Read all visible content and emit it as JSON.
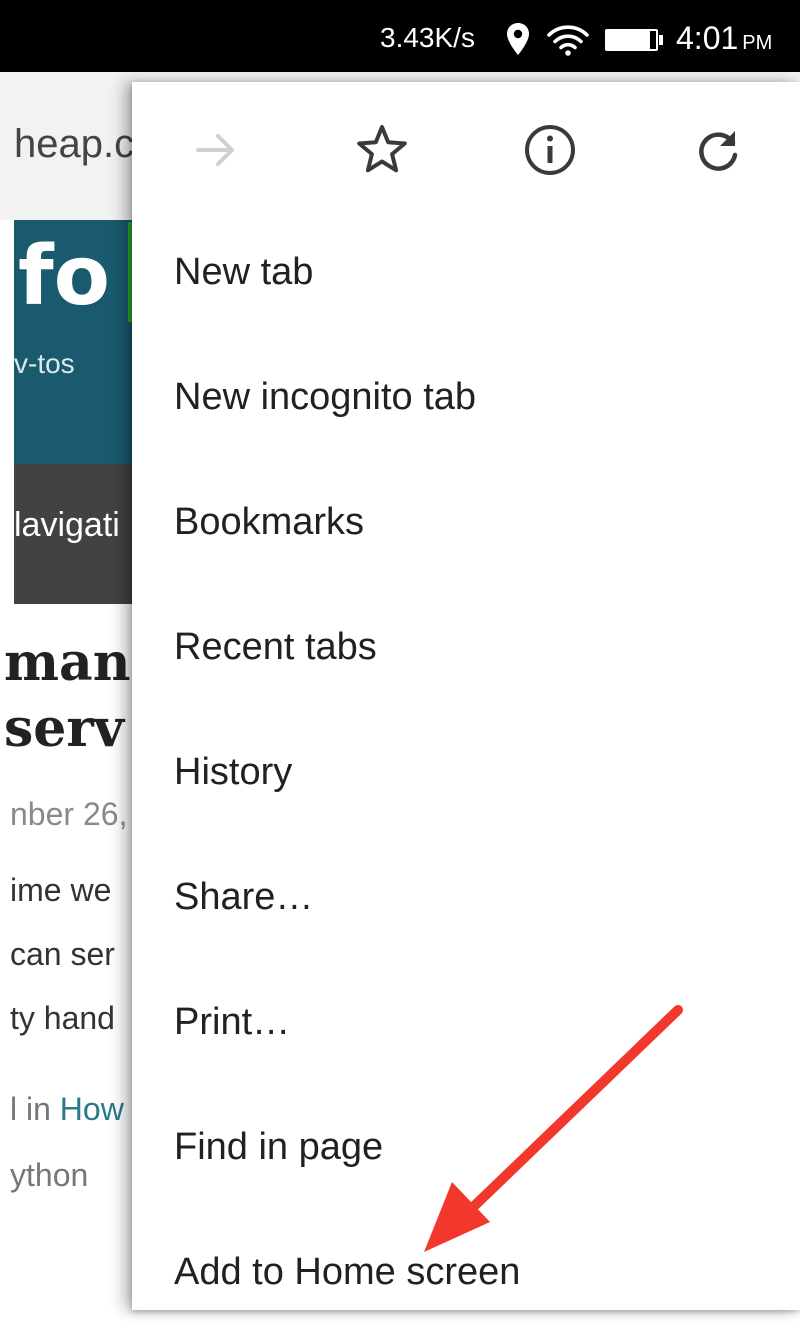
{
  "status_bar": {
    "net_speed": "3.43K/s",
    "time": "4:01",
    "ampm": "PM"
  },
  "web_page": {
    "url_text": "heap.c",
    "logo_text": "fo",
    "tagline": "v-tos",
    "nav_text": "lavigati",
    "title_lines": [
      "man",
      "serv"
    ],
    "date_fragment": "nber 26,",
    "body_lines": [
      "ime we",
      "can ser",
      "ty hand"
    ],
    "category_prefix": "l in ",
    "category_link": "How",
    "tag": "ython"
  },
  "menu": {
    "toolbar": [
      {
        "name": "forward",
        "icon": "arrow-forward-icon",
        "enabled": false
      },
      {
        "name": "bookmark",
        "icon": "star-outline-icon",
        "enabled": true
      },
      {
        "name": "page-info",
        "icon": "info-circle-icon",
        "enabled": true
      },
      {
        "name": "reload",
        "icon": "refresh-icon",
        "enabled": true
      }
    ],
    "items": [
      {
        "label": "New tab"
      },
      {
        "label": "New incognito tab"
      },
      {
        "label": "Bookmarks"
      },
      {
        "label": "Recent tabs"
      },
      {
        "label": "History"
      },
      {
        "label": "Share…"
      },
      {
        "label": "Print…"
      },
      {
        "label": "Find in page"
      },
      {
        "label": "Add to Home screen"
      }
    ]
  },
  "colors": {
    "header_teal": "#1a5a6e",
    "logo_green": "#2eaa2e",
    "nav_gray": "#424242",
    "annotation_red": "#f2382c"
  }
}
